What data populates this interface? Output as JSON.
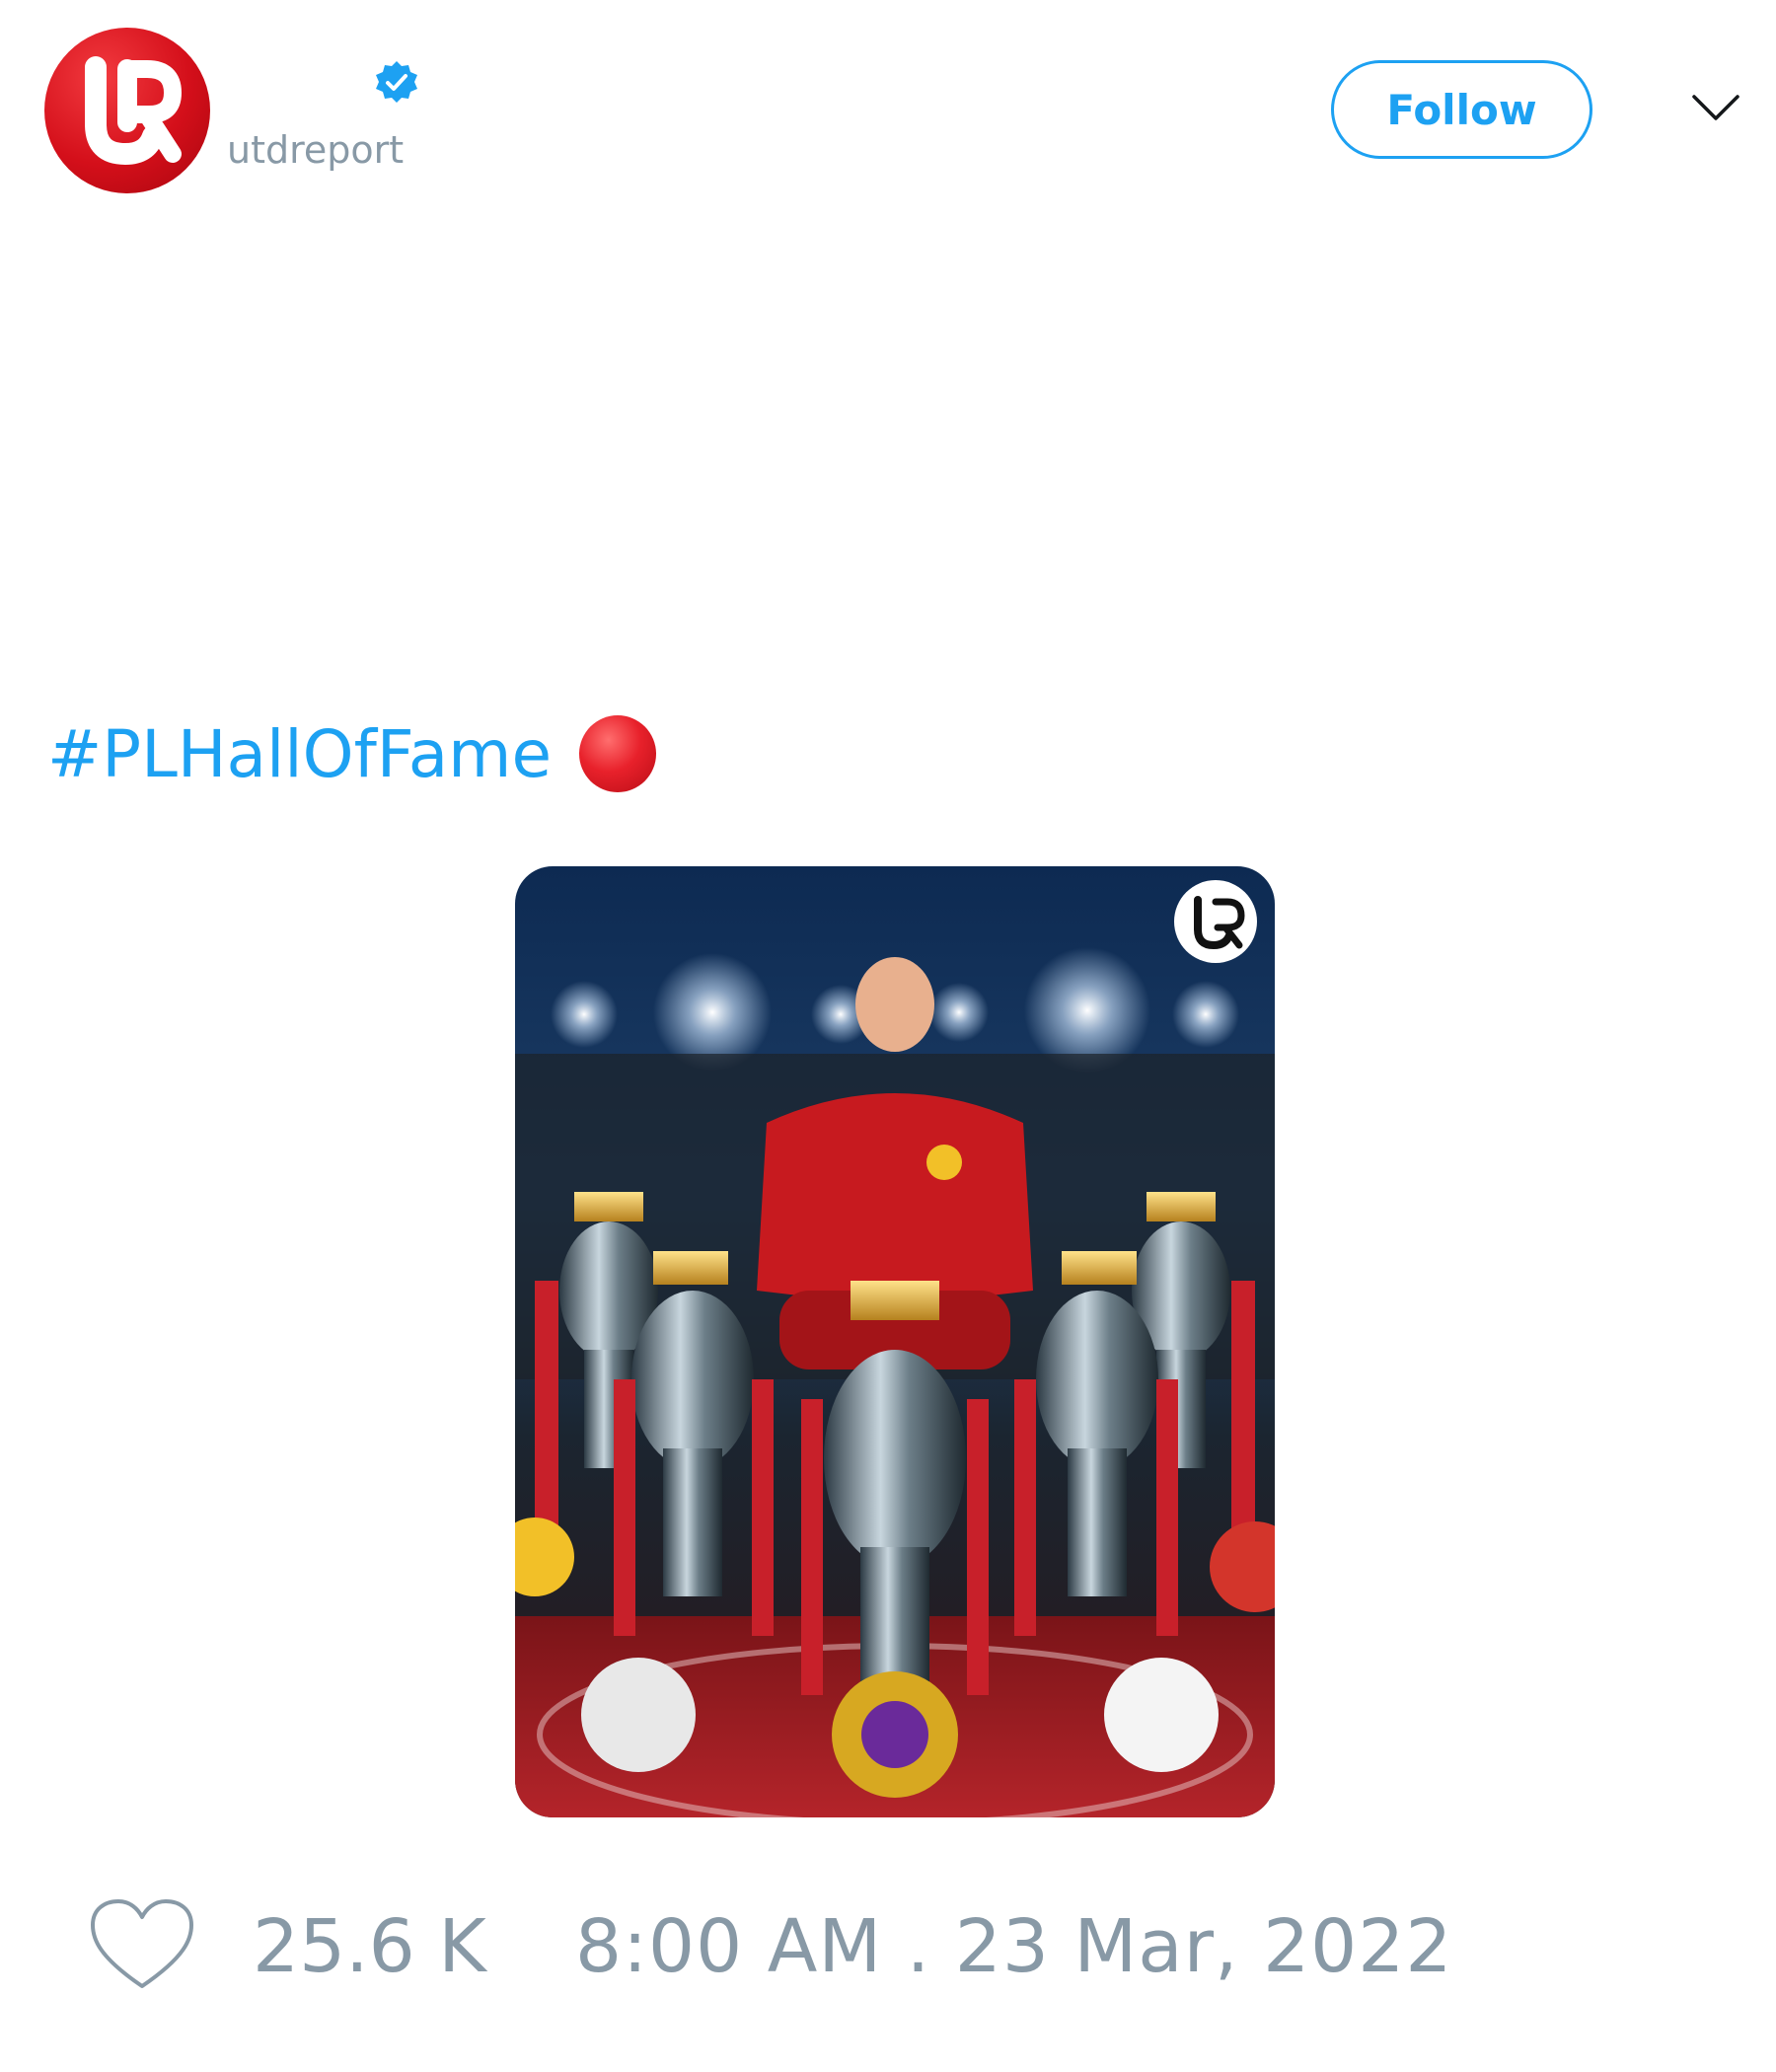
{
  "account": {
    "display_name": "",
    "handle": "utdreport",
    "verified": true,
    "avatar_icon": "ur-logo-icon",
    "avatar_color": "#d40f1a"
  },
  "actions": {
    "follow_label": "Follow",
    "menu_icon": "chevron-down-icon"
  },
  "tweet": {
    "text": "#PLHallOfFame",
    "emoji_icon": "red-circle-icon",
    "media_icon": "photo-icon"
  },
  "footer": {
    "like_icon": "heart-icon",
    "like_count": "25.6 K",
    "timestamp": "8:00 AM . 23 Mar, 2022"
  },
  "colors": {
    "accent": "#1da1f2",
    "muted": "#8899a6",
    "brand_red": "#d40f1a"
  }
}
